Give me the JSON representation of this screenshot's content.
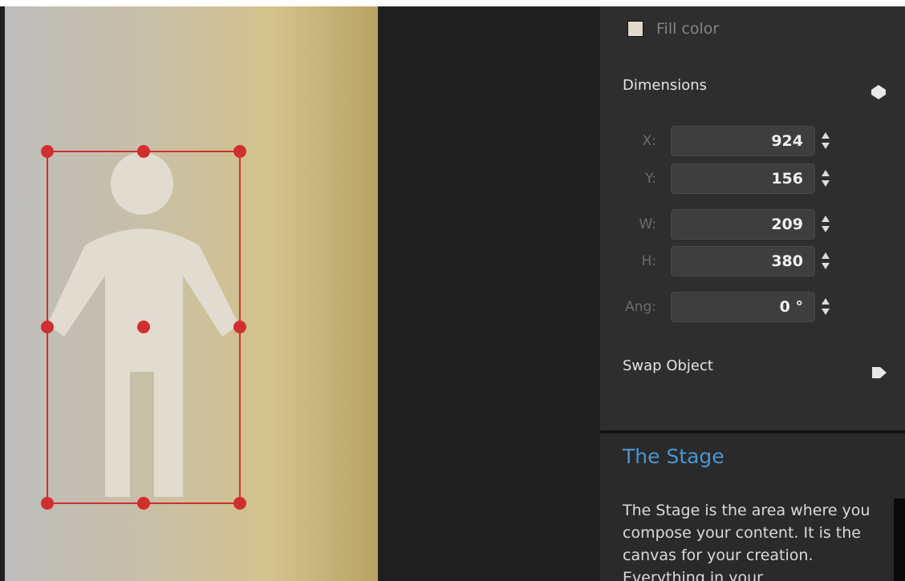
{
  "properties": {
    "fill": {
      "label": "Fill color",
      "swatch_color": "#e0d9cc"
    },
    "dimensions": {
      "title": "Dimensions",
      "fields": [
        {
          "key": "x",
          "label": "X:",
          "value": "924"
        },
        {
          "key": "y",
          "label": "Y:",
          "value": "156"
        },
        {
          "key": "w",
          "label": "W:",
          "value": "209"
        },
        {
          "key": "h",
          "label": "H:",
          "value": "380"
        },
        {
          "key": "ang",
          "label": "Ang:",
          "value": "0 °"
        }
      ]
    },
    "swap": {
      "title": "Swap Object"
    }
  },
  "help": {
    "title": "The Stage",
    "body": "The Stage is the area where you compose your content. It is the canvas for your creation. Everything in your"
  },
  "stage": {
    "object": "person-icon",
    "selection_color": "#d12f2f",
    "figure_color": "#e2dbcf"
  },
  "colors": {
    "accent": "#4a95d2",
    "panel_bg": "#2e2e2e",
    "handle": "#d12f2f"
  }
}
